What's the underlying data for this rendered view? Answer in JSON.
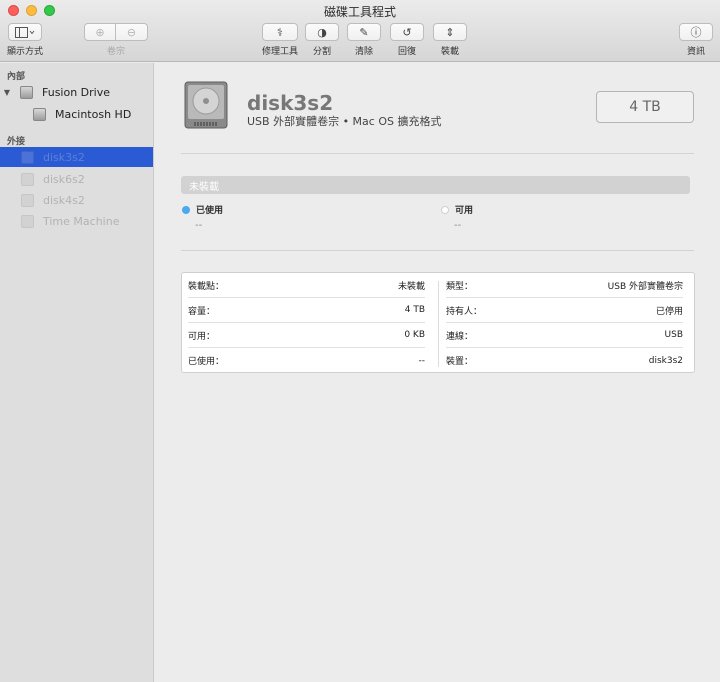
{
  "window": {
    "title": "磁碟工具程式"
  },
  "toolbar": {
    "view_label": "顯示方式",
    "volume_label": "卷宗",
    "first_aid_label": "修理工具",
    "partition_label": "分割",
    "erase_label": "清除",
    "restore_label": "回復",
    "mount_label": "裝載",
    "info_label": "資訊"
  },
  "sidebar": {
    "internal_header": "內部",
    "external_header": "外接",
    "internal": [
      {
        "label": "Fusion Drive"
      },
      {
        "label": "Macintosh HD"
      }
    ],
    "external": [
      {
        "label": "disk3s2",
        "selected": true
      },
      {
        "label": "disk6s2"
      },
      {
        "label": "disk4s2"
      },
      {
        "label": "Time Machine"
      }
    ]
  },
  "disk": {
    "name": "disk3s2",
    "subtitle": "USB 外部實體卷宗 • Mac OS 擴充格式",
    "capacity": "4 TB"
  },
  "usage": {
    "bar_label": "未裝載",
    "used_label": "已使用",
    "used_value": "--",
    "free_label": "可用",
    "free_value": "--",
    "used_color": "#4aa9f1"
  },
  "info": {
    "left": [
      {
        "key": "裝載點：",
        "value": "未裝載"
      },
      {
        "key": "容量：",
        "value": "4 TB"
      },
      {
        "key": "可用：",
        "value": "0 KB"
      },
      {
        "key": "已使用：",
        "value": "--"
      }
    ],
    "right": [
      {
        "key": "類型：",
        "value": "USB 外部實體卷宗"
      },
      {
        "key": "持有人：",
        "value": "已停用"
      },
      {
        "key": "連線：",
        "value": "USB"
      },
      {
        "key": "裝置：",
        "value": "disk3s2"
      }
    ]
  }
}
